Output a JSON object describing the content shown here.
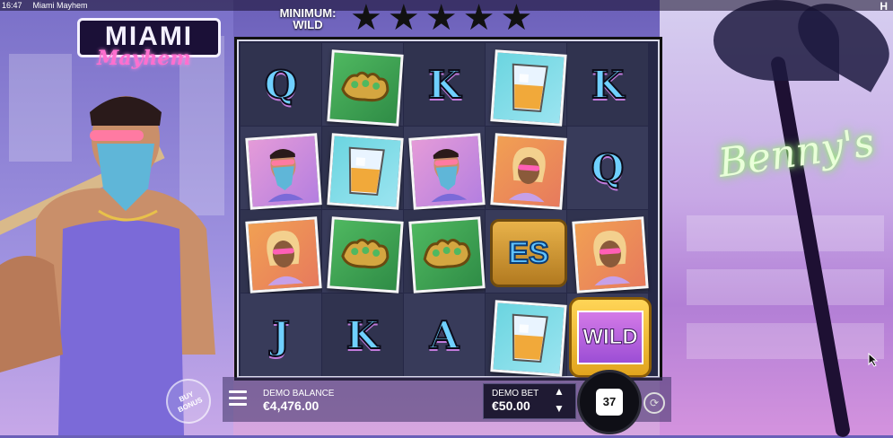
{
  "system": {
    "time": "16:47",
    "window_title": "Miami Mayhem"
  },
  "logo": {
    "line1": "MIAMI",
    "line2": "Mayhem"
  },
  "neon_sign": "Benny's",
  "minimum_wild": {
    "label": "MINIMUM: WILD",
    "stars_total": 5,
    "stars_lit": 0
  },
  "reels": [
    [
      {
        "type": "letter",
        "value": "Q"
      },
      {
        "type": "card",
        "icon": "brass-knuckles-icon",
        "bg": "green"
      },
      {
        "type": "letter",
        "value": "K"
      },
      {
        "type": "card",
        "icon": "whiskey-glass-icon",
        "bg": "teal"
      },
      {
        "type": "letter",
        "value": "K"
      }
    ],
    [
      {
        "type": "card",
        "icon": "bandana-man-icon",
        "bg": "pink"
      },
      {
        "type": "card",
        "icon": "whiskey-glass-icon",
        "bg": "teal"
      },
      {
        "type": "card",
        "icon": "bandana-man-icon",
        "bg": "pink"
      },
      {
        "type": "card",
        "icon": "blonde-woman-icon",
        "bg": "orange"
      },
      {
        "type": "letter",
        "value": "Q"
      }
    ],
    [
      {
        "type": "card",
        "icon": "blonde-woman-icon",
        "bg": "orange"
      },
      {
        "type": "card",
        "icon": "brass-knuckles-icon",
        "bg": "green"
      },
      {
        "type": "card",
        "icon": "brass-knuckles-icon",
        "bg": "green"
      },
      {
        "type": "scatter",
        "value": "ES"
      },
      {
        "type": "card",
        "icon": "blonde-woman-icon",
        "bg": "orange"
      }
    ],
    [
      {
        "type": "letter",
        "value": "J"
      },
      {
        "type": "letter",
        "value": "K"
      },
      {
        "type": "letter",
        "value": "A"
      },
      {
        "type": "card",
        "icon": "whiskey-glass-icon",
        "bg": "teal"
      },
      {
        "type": "wild",
        "value": "WILD"
      }
    ]
  ],
  "controls": {
    "buy_bonus": "BUY BONUS",
    "balance_label": "DEMO BALANCE",
    "balance_value": "€4,476.00",
    "bet_label": "DEMO BET",
    "bet_value": "€50.00",
    "spin_count": "37"
  },
  "colors": {
    "accent_pink": "#ff6fcf",
    "neon_green": "#9ef07a",
    "letter_blue": "#6fd0ff"
  }
}
